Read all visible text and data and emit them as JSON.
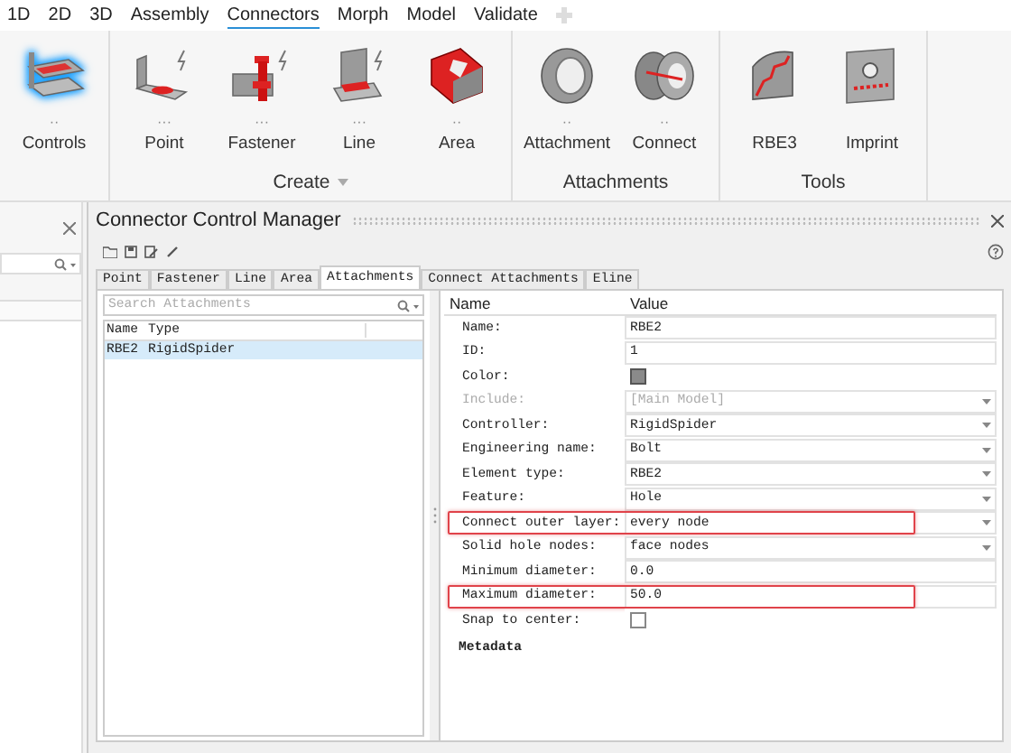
{
  "menu_tabs": [
    {
      "label": "1D",
      "selected": false
    },
    {
      "label": "2D",
      "selected": false
    },
    {
      "label": "3D",
      "selected": false
    },
    {
      "label": "Assembly",
      "selected": false
    },
    {
      "label": "Connectors",
      "selected": true
    },
    {
      "label": "Morph",
      "selected": false
    },
    {
      "label": "Model",
      "selected": false
    },
    {
      "label": "Validate",
      "selected": false
    }
  ],
  "ribbon": {
    "groups": [
      {
        "has_menu": false,
        "tools": [
          {
            "label": "Controls",
            "kind": "controls",
            "marker": "··",
            "selected": true
          }
        ]
      },
      {
        "label": "Create",
        "has_menu": true,
        "tools": [
          {
            "label": "Point",
            "kind": "point",
            "marker": "···",
            "selected": false
          },
          {
            "label": "Fastener",
            "kind": "fastener",
            "marker": "···",
            "selected": false
          },
          {
            "label": "Line",
            "kind": "line",
            "marker": "···",
            "selected": false
          },
          {
            "label": "Area",
            "kind": "area",
            "marker": "··",
            "selected": false
          }
        ]
      },
      {
        "label": "Attachments",
        "has_menu": false,
        "tools": [
          {
            "label": "Attachment",
            "kind": "attachment",
            "marker": "··",
            "selected": false
          },
          {
            "label": "Connect",
            "kind": "connect",
            "marker": "··",
            "selected": false
          }
        ]
      },
      {
        "label": "Tools",
        "has_menu": false,
        "tools": [
          {
            "label": "RBE3",
            "kind": "rbe3",
            "selected": false
          },
          {
            "label": "Imprint",
            "kind": "imprint",
            "selected": false
          }
        ]
      }
    ]
  },
  "dialog": {
    "title": "Connector Control Manager",
    "tabs": [
      {
        "label": "Point",
        "selected": false
      },
      {
        "label": "Fastener",
        "selected": false
      },
      {
        "label": "Line",
        "selected": false
      },
      {
        "label": "Area",
        "selected": false
      },
      {
        "label": "Attachments",
        "selected": true
      },
      {
        "label": "Connect Attachments",
        "selected": false
      },
      {
        "label": "Eline",
        "selected": false
      }
    ],
    "search": {
      "placeholder": "Search Attachments"
    },
    "list": {
      "columns": [
        "Name",
        "Type"
      ],
      "rows": [
        {
          "cells": [
            "RBE2",
            "RigidSpider"
          ],
          "selected": true
        }
      ]
    },
    "properties": {
      "columns": [
        "Name",
        "Value"
      ],
      "rows": [
        {
          "name": "Name:",
          "kind": "text",
          "value": "RBE2",
          "disabled": false,
          "highlighted": false
        },
        {
          "name": "ID:",
          "kind": "text",
          "value": "1",
          "disabled": false,
          "highlighted": false
        },
        {
          "name": "Color:",
          "kind": "color",
          "color": "#8a8a8a",
          "disabled": false,
          "highlighted": false
        },
        {
          "name": "Include:",
          "kind": "dropdown",
          "value": "[Main Model]",
          "disabled": true,
          "highlighted": false
        },
        {
          "name": "Controller:",
          "kind": "dropdown",
          "value": "RigidSpider",
          "disabled": false,
          "highlighted": false
        },
        {
          "name": "Engineering name:",
          "kind": "dropdown",
          "value": "Bolt",
          "disabled": false,
          "highlighted": false
        },
        {
          "name": "Element type:",
          "kind": "dropdown",
          "value": "RBE2",
          "disabled": false,
          "highlighted": false
        },
        {
          "name": "Feature:",
          "kind": "dropdown",
          "value": "Hole",
          "disabled": false,
          "highlighted": false
        },
        {
          "name": "Connect outer layer:",
          "kind": "dropdown",
          "value": "every node",
          "disabled": false,
          "highlighted": true
        },
        {
          "name": "Solid hole nodes:",
          "kind": "dropdown",
          "value": "face nodes",
          "disabled": false,
          "highlighted": false
        },
        {
          "name": "Minimum diameter:",
          "kind": "text",
          "value": "0.0",
          "disabled": false,
          "highlighted": false
        },
        {
          "name": "Maximum diameter:",
          "kind": "text",
          "value": "50.0",
          "disabled": false,
          "highlighted": true
        },
        {
          "name": "Snap to center:",
          "kind": "checkbox",
          "checked": false,
          "disabled": false,
          "highlighted": false
        }
      ],
      "section": "Metadata"
    }
  }
}
